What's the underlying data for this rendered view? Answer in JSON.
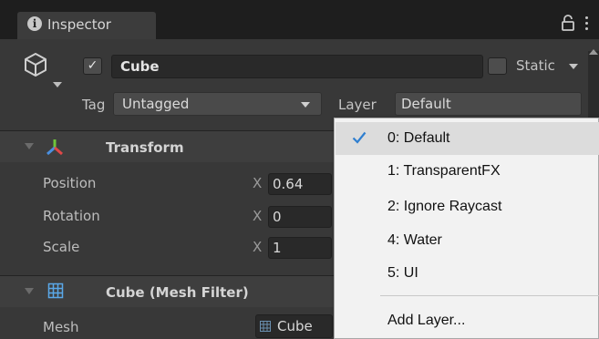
{
  "tab": {
    "title": "Inspector"
  },
  "object": {
    "name": "Cube",
    "active": true,
    "static_label": "Static"
  },
  "tag": {
    "label": "Tag",
    "value": "Untagged"
  },
  "layer": {
    "label": "Layer",
    "value": "Default"
  },
  "transform": {
    "title": "Transform",
    "rows": [
      {
        "label": "Position",
        "axis": "X",
        "value": "0.64"
      },
      {
        "label": "Rotation",
        "axis": "X",
        "value": "0"
      },
      {
        "label": "Scale",
        "axis": "X",
        "value": "1"
      }
    ]
  },
  "mesh_filter": {
    "title": "Cube (Mesh Filter)",
    "mesh_label": "Mesh",
    "mesh_value": "Cube"
  },
  "layer_menu": {
    "items": [
      {
        "label": "0: Default",
        "selected": true
      },
      {
        "label": "1: TransparentFX",
        "selected": false
      },
      {
        "label": "2: Ignore Raycast",
        "selected": false
      },
      {
        "label": "4: Water",
        "selected": false
      },
      {
        "label": "5: UI",
        "selected": false
      }
    ],
    "add_label": "Add Layer..."
  },
  "colors": {
    "panel_bg": "#383838",
    "tab_bar_bg": "#1e1e1e",
    "menu_bg": "#f2f2f2",
    "menu_selected_bg": "#dcdcdc",
    "check_color": "#2f7fd0",
    "transform_axis_red": "#e04848",
    "transform_axis_green": "#6fc43a",
    "transform_axis_blue": "#4a8fe0",
    "mesh_icon_blue": "#5aa8e8"
  }
}
